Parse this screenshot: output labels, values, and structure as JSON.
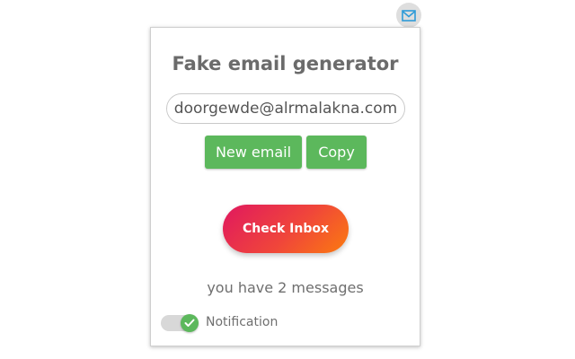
{
  "extension": {
    "icon": "envelope-icon",
    "icon_color": "#2e9bd8"
  },
  "popup": {
    "title": "Fake email generator",
    "email_value": "doorgewde@alrmalakna.com",
    "new_email_label": "New email",
    "copy_label": "Copy",
    "check_inbox_label": "Check Inbox",
    "messages_text": "you have 2 messages",
    "notification": {
      "label": "Notification",
      "enabled": true
    }
  },
  "colors": {
    "button_green": "#5cb85c",
    "gradient_start": "#e0185f",
    "gradient_end": "#fb7b0f",
    "title_gray": "#6b6b6b"
  }
}
